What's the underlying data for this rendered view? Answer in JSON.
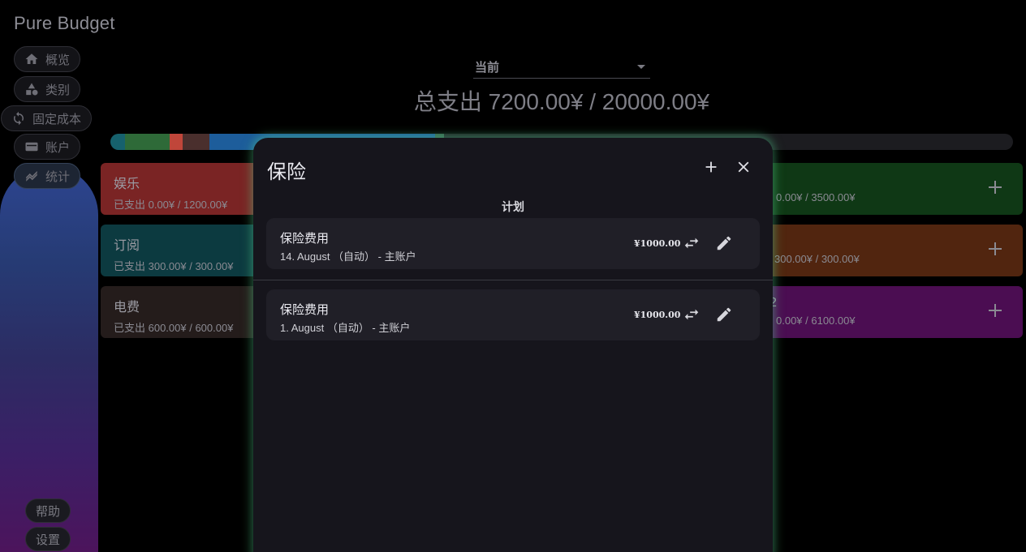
{
  "app": {
    "title": "Pure Budget"
  },
  "nav": {
    "overview": "概览",
    "categories": "类别",
    "fixed_costs": "固定成本",
    "accounts": "账户",
    "statistics": "统计",
    "help": "帮助",
    "settings": "设置"
  },
  "header": {
    "period": "当前",
    "total": "总支出 7200.00¥ / 20000.00¥"
  },
  "budget_bar": {
    "segments": [
      {
        "color": "#16616d",
        "fraction": 0.016
      },
      {
        "color": "#2e6a38",
        "fraction": 0.05
      },
      {
        "color": "#c0463a",
        "fraction": 0.014
      },
      {
        "color": "#4a2f2d",
        "fraction": 0.03
      },
      {
        "color": "#1d5d9b",
        "fraction": 0.25
      },
      {
        "color": "#35604a",
        "fraction": 0.01
      }
    ],
    "track_color": "#1c1c20"
  },
  "categories": [
    {
      "name": "娱乐",
      "amount": "已支出 0.00¥ / 1200.00¥",
      "color": "#7a2424"
    },
    {
      "name": "订阅",
      "amount": "已支出 300.00¥ / 300.00¥",
      "color": "#0c3a40"
    },
    {
      "name": "电费",
      "amount": "已支出 600.00¥ / 600.00¥",
      "color": "#241c1b"
    }
  ],
  "right_cards": [
    {
      "amount": "0.00¥ / 3500.00¥",
      "color": "#0f3815"
    },
    {
      "amount": "300.00¥ / 300.00¥",
      "color": "#51250f"
    },
    {
      "name": "2",
      "amount": "0.00¥ / 6100.00¥",
      "color": "#4b0d52"
    }
  ],
  "dialog": {
    "title": "保险",
    "section": "计划",
    "entries": [
      {
        "title": "保险费用",
        "detail": "14. August （自动） - 主账户",
        "value": "¥1000.00"
      },
      {
        "title": "保险费用",
        "detail": "1. August （自动） - 主账户",
        "value": "¥1000.00"
      }
    ]
  },
  "icons": {
    "overview": "home-icon",
    "categories": "shapes-icon",
    "fixed_costs": "sync-icon",
    "accounts": "wallet-icon",
    "statistics": "chart-icon",
    "add": "plus-icon",
    "close": "close-icon",
    "transfer": "swap-icon",
    "edit": "pencil-icon"
  }
}
